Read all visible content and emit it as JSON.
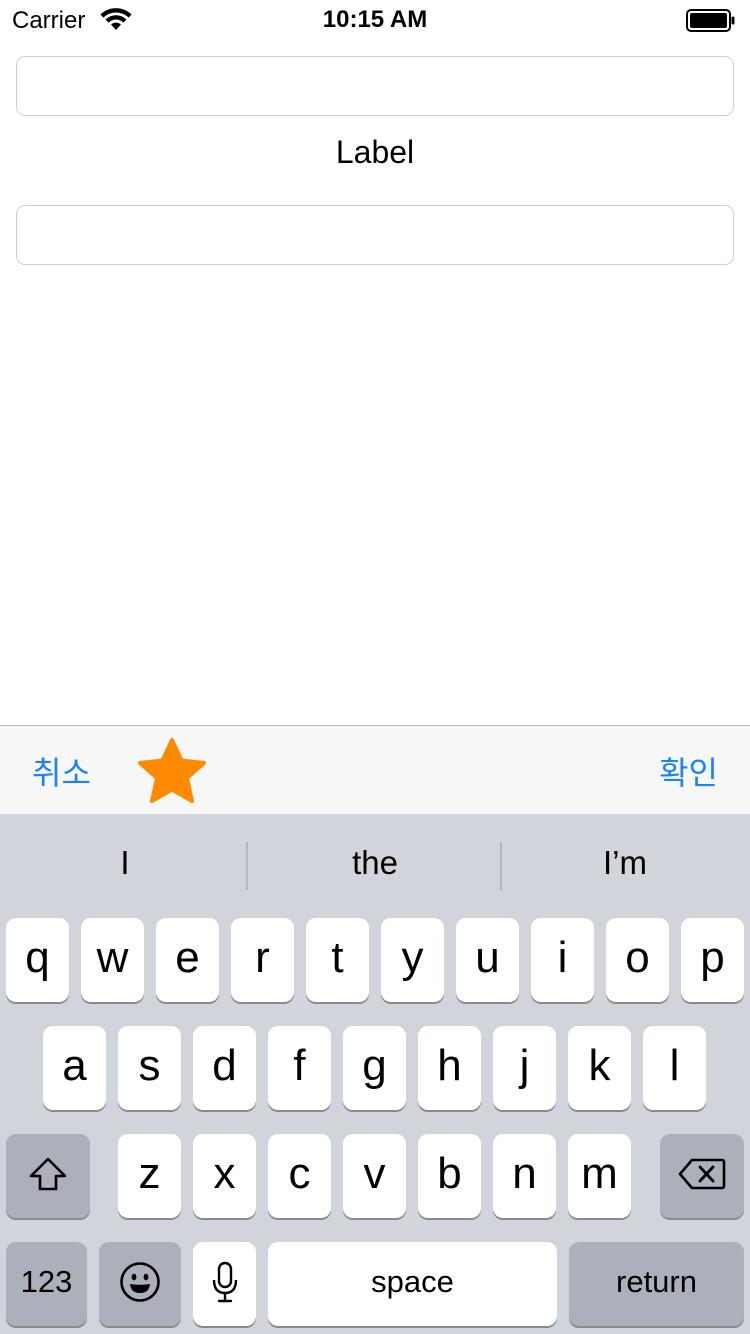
{
  "status_bar": {
    "carrier": "Carrier",
    "time": "10:15 AM",
    "wifi_icon": "wifi-icon",
    "battery_icon": "battery-icon"
  },
  "content": {
    "top_field": {
      "value": "",
      "placeholder": ""
    },
    "label": "Label",
    "bottom_field": {
      "value": "",
      "placeholder": ""
    }
  },
  "toolbar": {
    "cancel_label": "취소",
    "confirm_label": "확인",
    "star_icon": "star-icon",
    "accent_color": "#1a82fb",
    "star_color": "#ff8a00"
  },
  "keyboard": {
    "suggestions": [
      "I",
      "the",
      "I’m"
    ],
    "row1": [
      "q",
      "w",
      "e",
      "r",
      "t",
      "y",
      "u",
      "i",
      "o",
      "p"
    ],
    "row2": [
      "a",
      "s",
      "d",
      "f",
      "g",
      "h",
      "j",
      "k",
      "l"
    ],
    "row3": [
      "z",
      "x",
      "c",
      "v",
      "b",
      "n",
      "m"
    ],
    "numbers_label": "123",
    "space_label": "space",
    "return_label": "return",
    "icons": [
      "shift-icon",
      "backspace-icon",
      "emoji-icon",
      "microphone-icon"
    ]
  }
}
